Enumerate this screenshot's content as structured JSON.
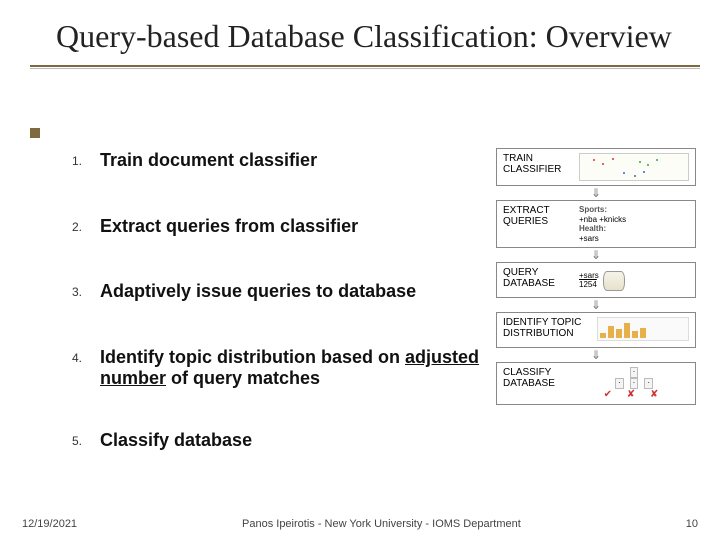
{
  "title": "Query-based Database Classification: Overview",
  "steps": [
    {
      "num": "1.",
      "text": "Train document classifier",
      "box": "TRAIN CLASSIFIER"
    },
    {
      "num": "2.",
      "text": "Extract queries from classifier",
      "box": "EXTRACT QUERIES",
      "side": {
        "l1": "Sports:",
        "l2": "+nba +knicks",
        "l3": "Health:",
        "l4": "+sars"
      }
    },
    {
      "num": "3.",
      "text": "Adaptively issue queries to database",
      "box": "QUERY DATABASE",
      "side": {
        "q": "+sars",
        "n": "1254"
      }
    },
    {
      "num": "4.",
      "text_pre": "Identify topic distribution based on ",
      "adj": "adjusted",
      "mid": " ",
      "nu": "number",
      "text_post": " of query matches",
      "box": "IDENTIFY TOPIC DISTRIBUTION"
    },
    {
      "num": "5.",
      "text": "Classify database",
      "box": "CLASSIFY DATABASE"
    }
  ],
  "footer": {
    "date": "12/19/2021",
    "center": "Panos Ipeirotis - New York University - IOMS Department",
    "page": "10"
  }
}
